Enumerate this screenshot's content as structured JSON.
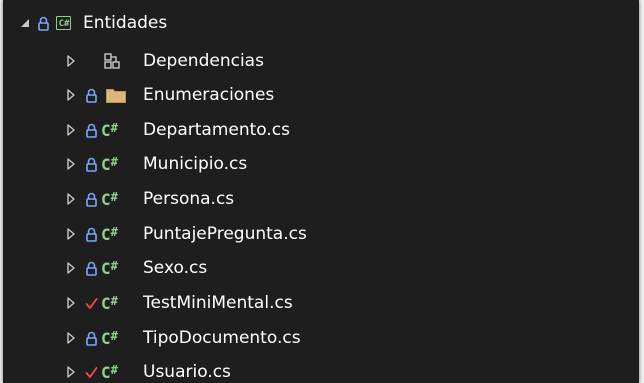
{
  "colors": {
    "background": "#1e1e1e",
    "text": "#ffffff",
    "lock": "#7aa8ff",
    "check": "#ee4b4b",
    "csharp": "#8fd18a",
    "folder": "#dcb67a",
    "arrow": "#c8c8c8"
  },
  "tree": {
    "project": {
      "label": "Entidades",
      "icon": "csharp-project-icon",
      "glyph": "C#",
      "expanded": true
    },
    "items": [
      {
        "label": "Dependencias",
        "icon": "dependencies-icon",
        "status": "none"
      },
      {
        "label": "Enumeraciones",
        "icon": "folder-icon",
        "status": "lock"
      },
      {
        "label": "Departamento.cs",
        "icon": "csharp-file-icon",
        "status": "lock"
      },
      {
        "label": "Municipio.cs",
        "icon": "csharp-file-icon",
        "status": "lock"
      },
      {
        "label": "Persona.cs",
        "icon": "csharp-file-icon",
        "status": "lock"
      },
      {
        "label": "PuntajePregunta.cs",
        "icon": "csharp-file-icon",
        "status": "lock"
      },
      {
        "label": "Sexo.cs",
        "icon": "csharp-file-icon",
        "status": "lock"
      },
      {
        "label": "TestMiniMental.cs",
        "icon": "csharp-file-icon",
        "status": "check"
      },
      {
        "label": "TipoDocumento.cs",
        "icon": "csharp-file-icon",
        "status": "lock"
      },
      {
        "label": "Usuario.cs",
        "icon": "csharp-file-icon",
        "status": "check"
      }
    ],
    "cs_glyph": "C",
    "cs_hash": "#"
  }
}
